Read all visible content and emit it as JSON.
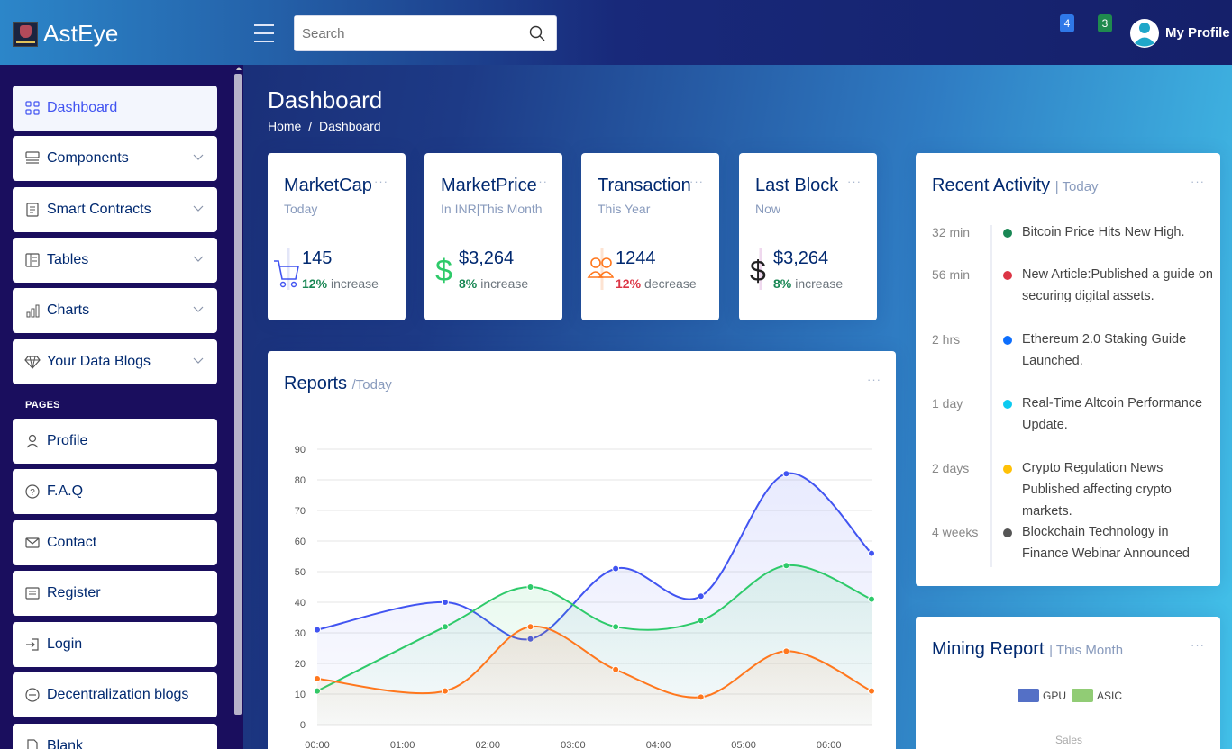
{
  "header": {
    "app_name": "AstEye",
    "search_placeholder": "Search",
    "notif_count_1": "4",
    "notif_count_2": "3",
    "profile_label": "My Profile"
  },
  "sidebar": {
    "items": [
      {
        "label": "Dashboard",
        "icon": "grid-icon"
      },
      {
        "label": "Components",
        "icon": "menu-button-icon"
      },
      {
        "label": "Smart Contracts",
        "icon": "journal-text-icon"
      },
      {
        "label": "Tables",
        "icon": "layout-text-icon"
      },
      {
        "label": "Charts",
        "icon": "bar-chart-icon"
      },
      {
        "label": "Your Data Blogs",
        "icon": "gem-icon"
      }
    ],
    "pages_heading": "PAGES",
    "pages": [
      {
        "label": "Profile",
        "icon": "person-icon"
      },
      {
        "label": "F.A.Q",
        "icon": "question-circle-icon"
      },
      {
        "label": "Contact",
        "icon": "envelope-icon"
      },
      {
        "label": "Register",
        "icon": "card-list-icon"
      },
      {
        "label": "Login",
        "icon": "box-arrow-in-right-icon"
      },
      {
        "label": "Decentralization blogs",
        "icon": "dash-circle-icon"
      },
      {
        "label": "Blank",
        "icon": "file-icon"
      }
    ]
  },
  "main": {
    "title": "Dashboard",
    "breadcrumb": [
      "Home",
      "/",
      "Dashboard"
    ],
    "cards": [
      {
        "title": "MarketCap",
        "sub": "Today",
        "value": "145",
        "pct": "12%",
        "change": "increase",
        "icon": "cart-icon"
      },
      {
        "title": "MarketPrice",
        "sub": "In INR|This Month",
        "value": "$3,264",
        "pct": "8%",
        "change": "increase",
        "icon": "currency-dollar-icon"
      },
      {
        "title": "Transaction",
        "sub": "This Year",
        "value": "1244",
        "pct": "12%",
        "change": "decrease",
        "icon": "people-icon"
      },
      {
        "title": "Last Block",
        "sub": "Now",
        "value": "$3,264",
        "pct": "8%",
        "change": "increase",
        "icon": "dollar-icon"
      }
    ],
    "dots": "···",
    "reports": {
      "title": "Reports",
      "filter": "/Today"
    },
    "activity": {
      "title": "Recent Activity",
      "filter": "| Today",
      "items": [
        {
          "time": "32 min",
          "text": "Bitcoin Price Hits New High.",
          "color": "#198754"
        },
        {
          "time": "56 min",
          "text": "New Article:Published a guide on securing digital assets.",
          "color": "#dc3545"
        },
        {
          "time": "2 hrs",
          "text": "Ethereum 2.0 Staking Guide Launched.",
          "color": "#0d6efd"
        },
        {
          "time": "1 day",
          "text": "Real-Time Altcoin Performance Update.",
          "color": "#0dcaf0"
        },
        {
          "time": "2 days",
          "text": "Crypto Regulation News Published affecting crypto markets.",
          "color": "#ffc107"
        },
        {
          "time": "4 weeks",
          "text": "Blockchain Technology in Finance Webinar Announced",
          "color": "#555555"
        }
      ]
    },
    "mining": {
      "title": "Mining Report",
      "filter": "| This Month",
      "legend": [
        {
          "name": "GPU",
          "color": "#5470c6"
        },
        {
          "name": "ASIC",
          "color": "#91cc75"
        }
      ],
      "sales_label": "Sales"
    }
  },
  "chart_data": {
    "type": "line",
    "x": [
      "00:00",
      "01:00",
      "02:00",
      "03:00",
      "04:00",
      "05:00",
      "06:00"
    ],
    "ylim": [
      0,
      90
    ],
    "yticks": [
      "0",
      "10",
      "20",
      "30",
      "40",
      "50",
      "60",
      "70",
      "80",
      "90"
    ],
    "series": [
      {
        "color": "#4154f1",
        "points": [
          [
            0,
            31
          ],
          [
            1.5,
            40
          ],
          [
            2.5,
            28
          ],
          [
            3.5,
            51
          ],
          [
            4.5,
            42
          ],
          [
            5.5,
            82
          ],
          [
            6.5,
            56
          ]
        ]
      },
      {
        "color": "#2eca6a",
        "points": [
          [
            0,
            11
          ],
          [
            1.5,
            32
          ],
          [
            2.5,
            45
          ],
          [
            3.5,
            32
          ],
          [
            4.5,
            34
          ],
          [
            5.5,
            52
          ],
          [
            6.5,
            41
          ]
        ]
      },
      {
        "color": "#ff771d",
        "points": [
          [
            0,
            15
          ],
          [
            1.5,
            11
          ],
          [
            2.5,
            32
          ],
          [
            3.5,
            18
          ],
          [
            4.5,
            9
          ],
          [
            5.5,
            24
          ],
          [
            6.5,
            11
          ]
        ]
      }
    ],
    "grid": true
  }
}
